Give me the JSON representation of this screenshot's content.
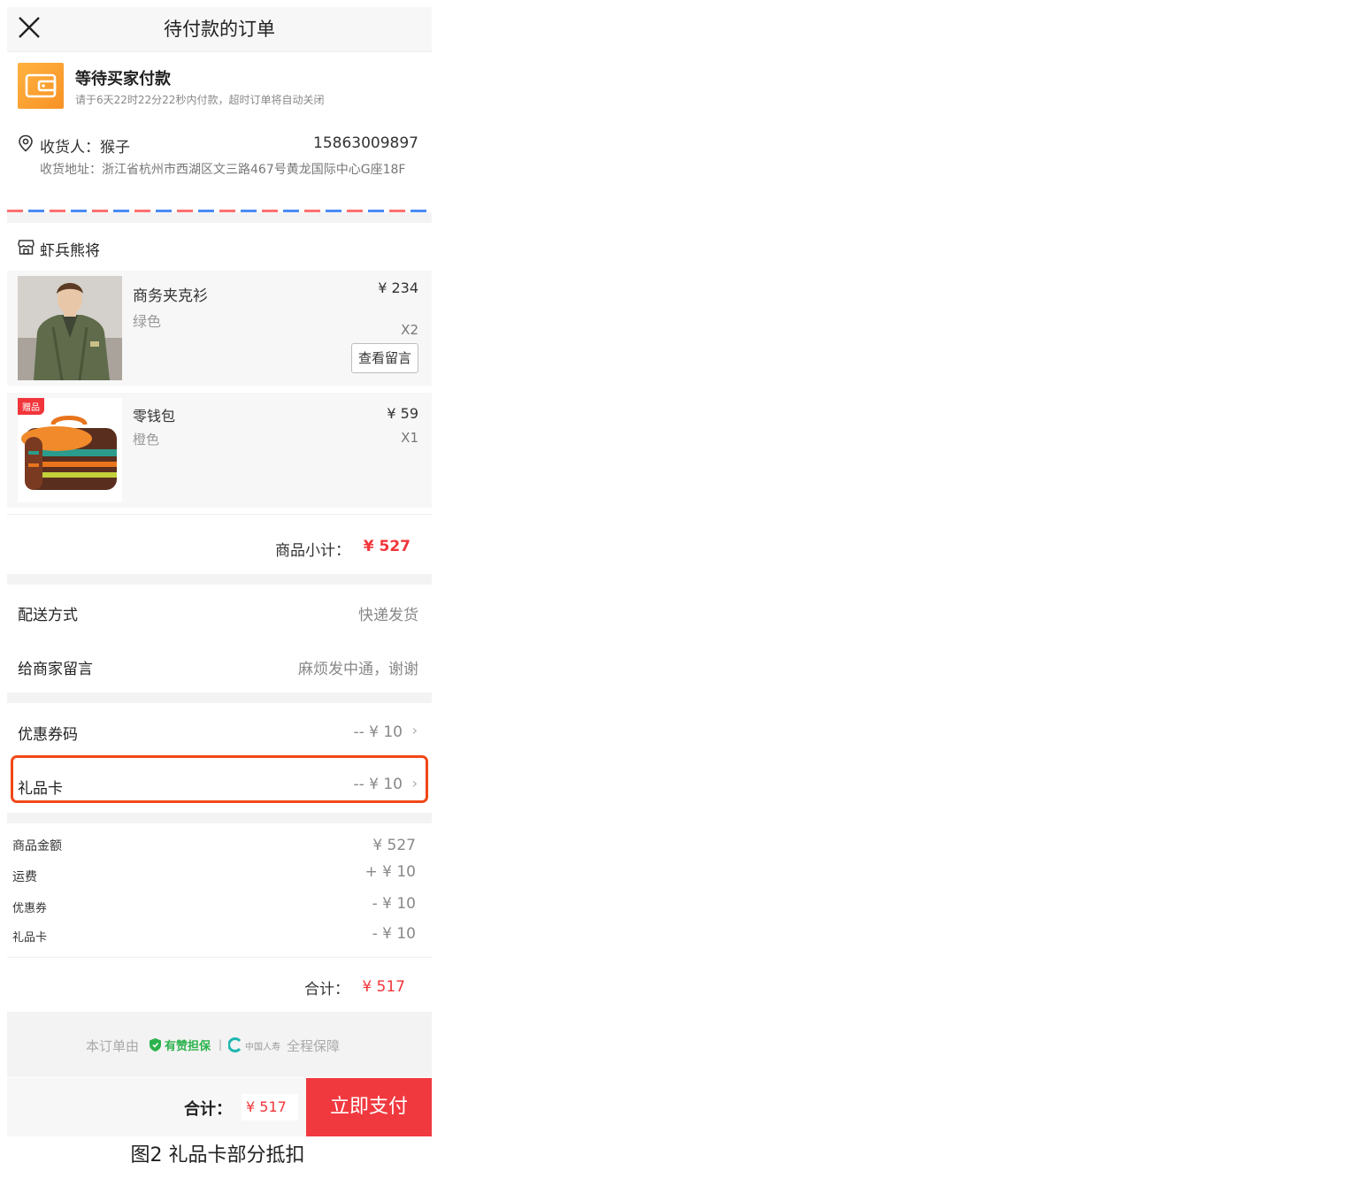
{
  "header": {
    "title": "待付款的订单",
    "close_icon": "close-icon"
  },
  "status": {
    "title": "等待买家付款",
    "subtitle": "请于6天22时22分22秒内付款，超时订单将自动关闭",
    "icon": "wallet-icon"
  },
  "address": {
    "recipient": "收货人：猴子",
    "phone": "15863009897",
    "address": "收货地址：浙江省杭州市西湖区文三路467号黄龙国际中心G座18F"
  },
  "shop": {
    "name": "虾兵熊将",
    "icon": "store-icon"
  },
  "items": [
    {
      "name": "商务夹克衫",
      "color": "绿色",
      "price": "¥ 234",
      "qty": "X2",
      "message_button": "查看留言"
    },
    {
      "name": "零钱包",
      "color": "橙色",
      "price": "¥ 59",
      "qty": "X1",
      "badge": "赠品"
    }
  ],
  "subtotal": {
    "label": "商品小计：",
    "value": "¥ 527"
  },
  "delivery": {
    "label": "配送方式",
    "value": "快递发货"
  },
  "note": {
    "label": "给商家留言",
    "value": "麻烦发中通，谢谢"
  },
  "coupon": {
    "label": "优惠券码",
    "value": "-- ¥ 10"
  },
  "giftcard": {
    "label": "礼品卡",
    "value": "-- ¥ 10"
  },
  "summary": [
    {
      "label": "商品金额",
      "value": "¥ 527"
    },
    {
      "label": "运费",
      "value": "+ ¥ 10"
    },
    {
      "label": "优惠券",
      "value": "- ¥ 10"
    },
    {
      "label": "礼品卡",
      "value": "- ¥ 10"
    }
  ],
  "total": {
    "label": "合计：",
    "value": "¥ 517"
  },
  "guarantee": {
    "prefix": "本订单由",
    "brand1": "有赞担保",
    "separator": "|",
    "brand2": "中国人寿",
    "suffix": "全程保障"
  },
  "bottom": {
    "total_label": "合计：",
    "total_value": "¥ 517",
    "pay_button": "立即支付"
  },
  "caption": "图2 礼品卡部分抵扣",
  "colors": {
    "accent_red": "#f1363b",
    "highlight": "#f24716",
    "wallet": "#f79226",
    "guarantee_green": "#2bb24c"
  }
}
